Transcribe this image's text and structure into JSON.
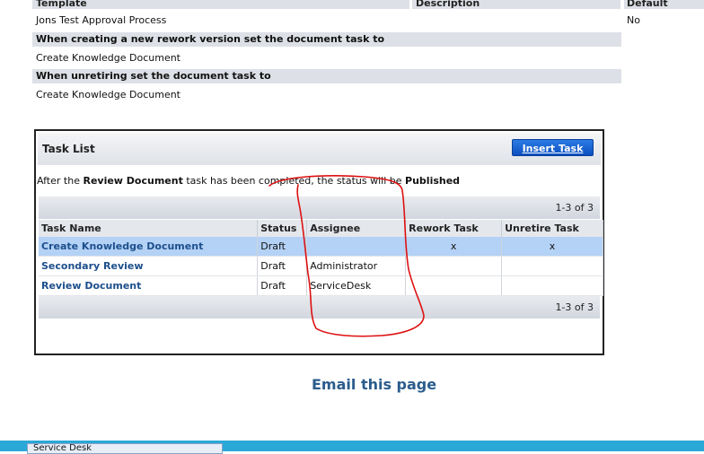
{
  "header": {
    "template_label": "Template",
    "description_label": "Description",
    "default_label": "Default",
    "template_value": "Jons Test Approval Process",
    "default_value": "No"
  },
  "sections": [
    {
      "title": "When creating a new rework version set the document task to",
      "value": "Create Knowledge Document"
    },
    {
      "title": "When unretiring set the document task to",
      "value": "Create Knowledge Document"
    }
  ],
  "task_list": {
    "title": "Task List",
    "insert_button": "Insert Task",
    "desc_prefix": "After the ",
    "desc_task": "Review Document",
    "desc_middle": " task has been completed, the status will be ",
    "desc_status": "Published",
    "pager_text": "1-3 of 3",
    "columns": [
      "Task Name",
      "Status",
      "Assignee",
      "Rework Task",
      "Unretire Task"
    ],
    "rows": [
      {
        "name": "Create Knowledge Document",
        "status": "Draft",
        "assignee": "",
        "rework": "x",
        "unretire": "x"
      },
      {
        "name": "Secondary Review",
        "status": "Draft",
        "assignee": "Administrator",
        "rework": "",
        "unretire": ""
      },
      {
        "name": "Review Document",
        "status": "Draft",
        "assignee": "ServiceDesk",
        "rework": "",
        "unretire": ""
      }
    ]
  },
  "email_link": "Email this page",
  "taskbar": {
    "item": "Service Desk"
  },
  "colors": {
    "annotation": "#dd1111",
    "link": "#1d4f8c",
    "button": "#0b4fc0",
    "selected_row": "#b4d2f6"
  }
}
